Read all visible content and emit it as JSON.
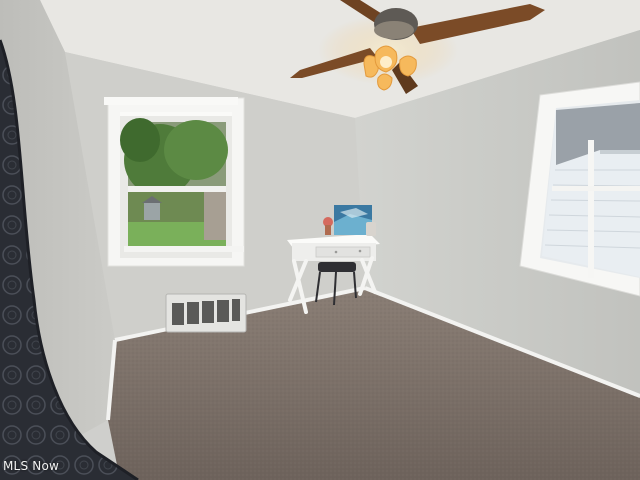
{
  "watermark": {
    "text": "MLS Now"
  },
  "colors": {
    "ceiling": "#e7e6e2",
    "wall_left": "#c8c8c4",
    "wall_back": "#d0d0cc",
    "wall_right": "#c9cac6",
    "carpet": "#7b7068",
    "baseboard": "#f2f2f0",
    "window_frame": "#f5f5f3",
    "fan_blade": "#7a4a26",
    "fan_glow": "#f7c46a",
    "curtain": "#2e3138",
    "desk": "#f1f1ef"
  }
}
